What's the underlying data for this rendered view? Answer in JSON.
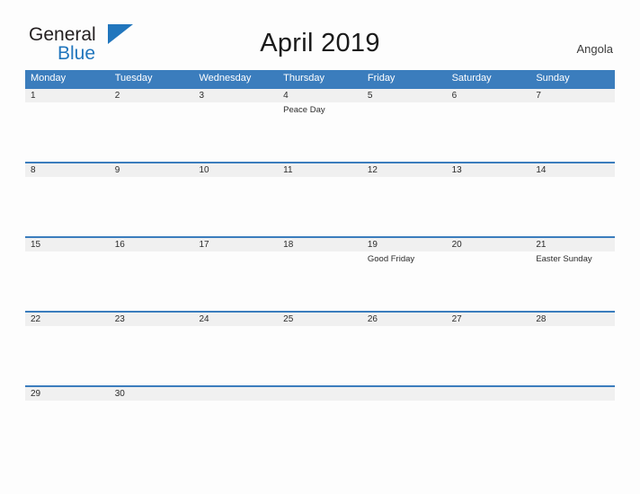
{
  "brand": {
    "name_part1": "General",
    "name_part2": "Blue",
    "flag_icon": "triangle-flag-icon"
  },
  "header": {
    "title": "April 2019",
    "country": "Angola"
  },
  "calendar": {
    "weekdays": [
      "Monday",
      "Tuesday",
      "Wednesday",
      "Thursday",
      "Friday",
      "Saturday",
      "Sunday"
    ],
    "accent_color": "#3b7dbd",
    "band_color": "#f0f0f0",
    "weeks": [
      {
        "days": [
          {
            "num": "1",
            "event": ""
          },
          {
            "num": "2",
            "event": ""
          },
          {
            "num": "3",
            "event": ""
          },
          {
            "num": "4",
            "event": "Peace Day"
          },
          {
            "num": "5",
            "event": ""
          },
          {
            "num": "6",
            "event": ""
          },
          {
            "num": "7",
            "event": ""
          }
        ]
      },
      {
        "days": [
          {
            "num": "8",
            "event": ""
          },
          {
            "num": "9",
            "event": ""
          },
          {
            "num": "10",
            "event": ""
          },
          {
            "num": "11",
            "event": ""
          },
          {
            "num": "12",
            "event": ""
          },
          {
            "num": "13",
            "event": ""
          },
          {
            "num": "14",
            "event": ""
          }
        ]
      },
      {
        "days": [
          {
            "num": "15",
            "event": ""
          },
          {
            "num": "16",
            "event": ""
          },
          {
            "num": "17",
            "event": ""
          },
          {
            "num": "18",
            "event": ""
          },
          {
            "num": "19",
            "event": "Good Friday"
          },
          {
            "num": "20",
            "event": ""
          },
          {
            "num": "21",
            "event": "Easter Sunday"
          }
        ]
      },
      {
        "days": [
          {
            "num": "22",
            "event": ""
          },
          {
            "num": "23",
            "event": ""
          },
          {
            "num": "24",
            "event": ""
          },
          {
            "num": "25",
            "event": ""
          },
          {
            "num": "26",
            "event": ""
          },
          {
            "num": "27",
            "event": ""
          },
          {
            "num": "28",
            "event": ""
          }
        ]
      },
      {
        "days": [
          {
            "num": "29",
            "event": ""
          },
          {
            "num": "30",
            "event": ""
          },
          {
            "num": "",
            "event": ""
          },
          {
            "num": "",
            "event": ""
          },
          {
            "num": "",
            "event": ""
          },
          {
            "num": "",
            "event": ""
          },
          {
            "num": "",
            "event": ""
          }
        ]
      }
    ]
  }
}
